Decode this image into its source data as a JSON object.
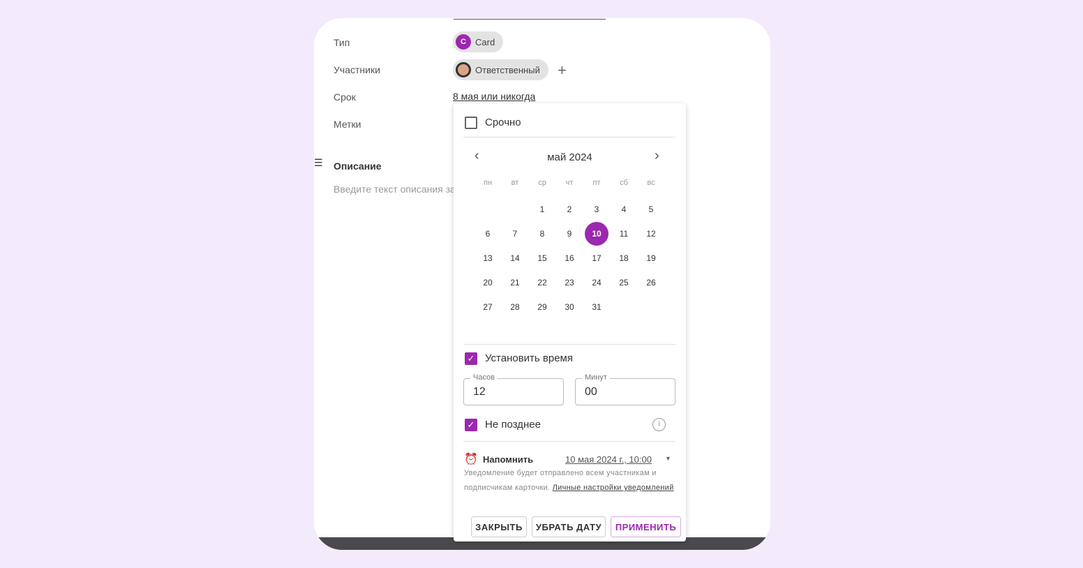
{
  "fields": {
    "type_label": "Тип",
    "type_value": "Card",
    "type_avatar_letter": "C",
    "participants_label": "Участники",
    "participant": "Ответственный",
    "due_label": "Срок",
    "due_value": "8 мая или никогда",
    "tags_label": "Метки"
  },
  "description": {
    "title": "Описание",
    "placeholder": "Введите текст описания за"
  },
  "popup": {
    "urgent_label": "Срочно",
    "urgent_checked": false,
    "month_title": "май 2024",
    "weekdays": [
      "пн",
      "вт",
      "ср",
      "чт",
      "пт",
      "сб",
      "вс"
    ],
    "selected_day": 10,
    "set_time_label": "Установить время",
    "set_time_checked": true,
    "hours_label": "Часов",
    "hours_value": "12",
    "minutes_label": "Минут",
    "minutes_value": "00",
    "not_later_label": "Не позднее",
    "not_later_checked": true,
    "remind_label": "Напомнить",
    "remind_value": "10 мая 2024 г., 10:00",
    "note_text": "Уведомление будет отправлено всем участникам и подписчикам карточки. ",
    "note_link": "Личные настройки уведомлений",
    "close_button": "ЗАКРЫТЬ",
    "clear_button": "УБРАТЬ ДАТУ",
    "apply_button": "ПРИМЕНИТЬ"
  },
  "colors": {
    "accent": "#9c27b0",
    "background": "#f3eafc"
  }
}
